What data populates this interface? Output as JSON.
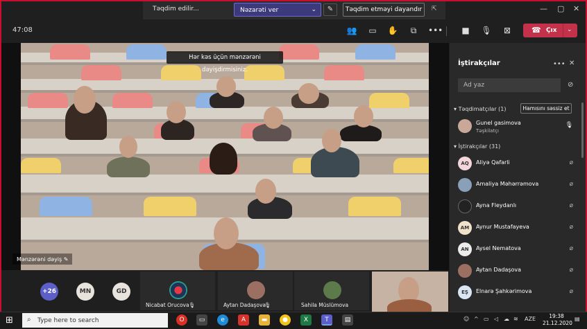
{
  "presenting_bar": {
    "status": "Təqdim edilir...",
    "control_select": "Nəzarəti ver",
    "stop_presenting": "Təqdim etməyi dayandır"
  },
  "meeting": {
    "timer": "47:08",
    "leave_label": "Çıx",
    "screen_caption": "Hər kəs üçün mənzərəni dəyişdirmisiniz.",
    "background_label": "Mənzərəni dəyiş"
  },
  "strip": {
    "overflow_count": "+26",
    "initial_bubbles": [
      {
        "initials": "MN",
        "color": "#e8e3dc"
      },
      {
        "initials": "GD",
        "color": "#e8e3dc"
      }
    ],
    "tiles": [
      {
        "name": "Nicabat Orucova"
      },
      {
        "name": "Aytan Dadaşova"
      },
      {
        "name": "Sahila Müslümova"
      }
    ]
  },
  "panel": {
    "title": "İştirakçılar",
    "search_placeholder": "Ad yaz",
    "presenters_heading": "Təqdimatçılar (1)",
    "mute_all": "Hamısını səssiz et",
    "presenter": {
      "name": "Gunel gasimova",
      "role": "Təşkilatçı"
    },
    "attendees_heading": "İştirakçılar (31)",
    "attendees": [
      {
        "name": "Aliyə Qafarli",
        "initials": "AQ",
        "color": "#f3d6dc"
      },
      {
        "name": "Amaliya Məhərrəmova",
        "initials": "",
        "color": "#8aa0b8"
      },
      {
        "name": "Ayna Fleydanlı",
        "initials": "",
        "color": "#222222"
      },
      {
        "name": "Aynur Mustafayeva",
        "initials": "AM",
        "color": "#f1e1c9"
      },
      {
        "name": "Aysel Nematova",
        "initials": "AN",
        "color": "#ececec"
      },
      {
        "name": "Aytan Dadaşova",
        "initials": "",
        "color": "#9c6f63"
      },
      {
        "name": "Elnarə Şahkərimova",
        "initials": "EŞ",
        "color": "#dbe6f5"
      }
    ]
  },
  "taskbar": {
    "search_placeholder": "Type here to search",
    "language": "AZE",
    "time": "19:38",
    "date": "21.12.2020"
  }
}
